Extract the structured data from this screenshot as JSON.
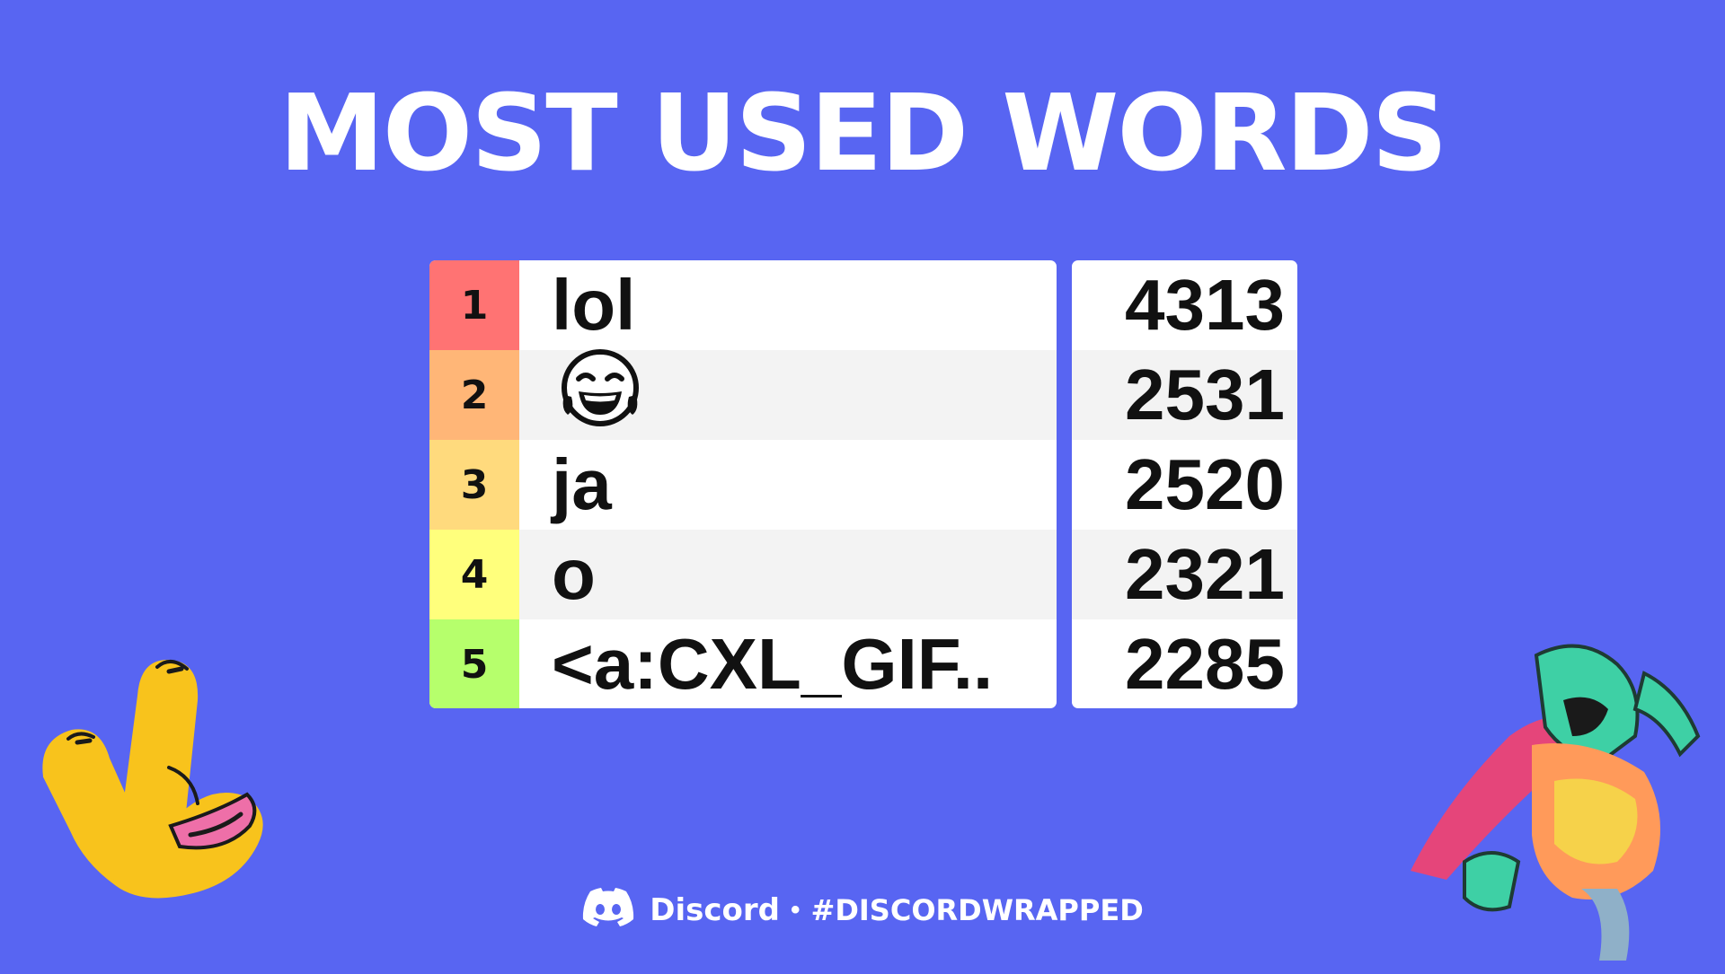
{
  "title": "MOST USED WORDS",
  "rows": [
    {
      "rank": "1",
      "word": "lol",
      "count": "4313",
      "color": "#FF7373"
    },
    {
      "rank": "2",
      "word": "",
      "emoji": "face-with-tears-of-joy",
      "count": "2531",
      "color": "#FFB677"
    },
    {
      "rank": "3",
      "word": "ja",
      "count": "2520",
      "color": "#FFDA7D"
    },
    {
      "rank": "4",
      "word": "o",
      "count": "2321",
      "color": "#FFFF7C"
    },
    {
      "rank": "5",
      "word": "<a:CXL_GIF..",
      "count": "2285",
      "color": "#B6FF6C"
    }
  ],
  "footer": {
    "brand": "Discord",
    "separator": "•",
    "hashtag": "#DISCORDWRAPPED",
    "logo_icon": "discord-logo-icon"
  },
  "decorations": {
    "left": "rock-hand-sticker",
    "right": "frog-character"
  },
  "colors": {
    "background": "#5865F2",
    "text": "#FFFFFF"
  }
}
